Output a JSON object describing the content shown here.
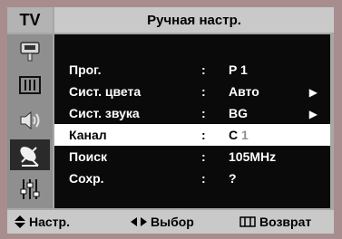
{
  "header": {
    "app_label": "TV",
    "title": "Ручная настр."
  },
  "sidebar": {
    "icons": [
      "input-icon",
      "picture-icon",
      "sound-icon",
      "channel-icon",
      "setup-icon"
    ]
  },
  "menu": {
    "rows": [
      {
        "label": "Прог.",
        "colon": ":",
        "value": "P 1",
        "arrow": ""
      },
      {
        "label": "Сист. цвета",
        "colon": ":",
        "value": "Авто",
        "arrow": "▶"
      },
      {
        "label": "Сист. звука",
        "colon": ":",
        "value": "BG",
        "arrow": "▶"
      },
      {
        "label": "Канал",
        "colon": ":",
        "value": "C",
        "value_suffix": "1",
        "arrow": ""
      },
      {
        "label": "Поиск",
        "colon": ":",
        "value": "105MHz",
        "arrow": ""
      },
      {
        "label": "Сохр.",
        "colon": ":",
        "value": "?",
        "arrow": ""
      }
    ]
  },
  "footer": {
    "adjust": "Настр.",
    "select": "Выбор",
    "back": "Возврат"
  },
  "colors": {
    "background": "#a88d8f",
    "panel": "#0a0a0a",
    "selected_row": "#ffffff"
  }
}
